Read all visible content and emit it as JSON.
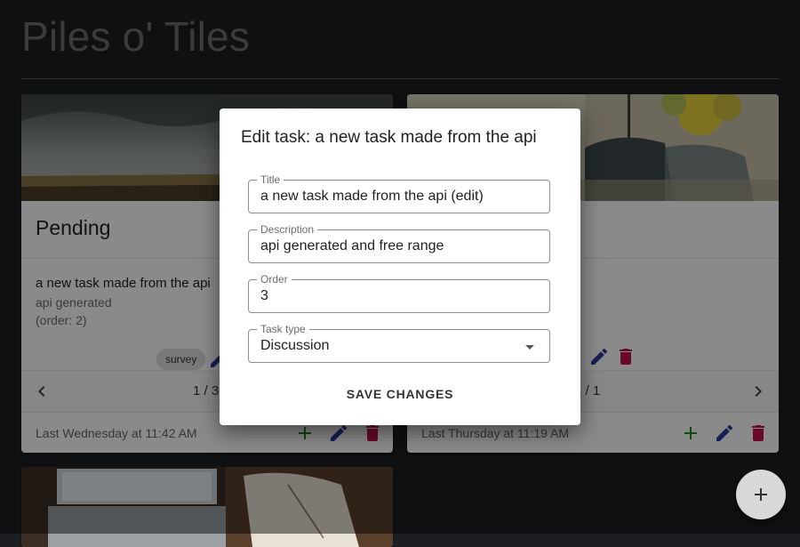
{
  "app": {
    "title": "Piles o' Tiles"
  },
  "colors": {
    "background": "#1d1e22",
    "edit": "#2d3a9e",
    "delete": "#c2124e",
    "add": "#1f8a1f"
  },
  "cards": [
    {
      "title": "Pending",
      "task": {
        "name": "a new task made from the api",
        "description": "api generated",
        "order": "(order: 2)"
      },
      "chip": "survey",
      "pager": "1 / 3",
      "footer_time": "Last Wednesday at 11:42 AM"
    },
    {
      "pager": "1 / 1",
      "footer_time": "Last Thursday at 11:19 AM"
    }
  ],
  "dialog": {
    "title": "Edit task: a new task made from the api",
    "fields": {
      "title": {
        "label": "Title",
        "value": "a new task made from the api (edit)"
      },
      "description": {
        "label": "Description",
        "value": "api generated and free range"
      },
      "order": {
        "label": "Order",
        "value": "3"
      },
      "task_type": {
        "label": "Task type",
        "value": "Discussion"
      }
    },
    "save_label": "SAVE CHANGES"
  },
  "icons": {
    "fab": "plus-icon",
    "prev": "chevron-left-icon",
    "next": "chevron-right-icon",
    "edit": "pencil-icon",
    "delete": "trash-icon",
    "add": "plus-icon",
    "select": "caret-down-icon"
  }
}
